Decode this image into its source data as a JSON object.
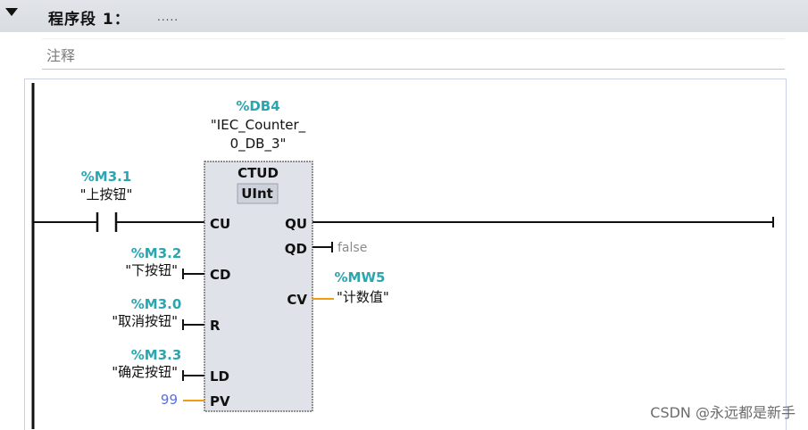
{
  "network": {
    "title": "程序段 1：",
    "title_dots": ".....",
    "comment": "注释"
  },
  "block": {
    "instance_address": "%DB4",
    "instance_name_line1": "\"IEC_Counter_",
    "instance_name_line2": "0_DB_3\"",
    "type": "CTUD",
    "datatype": "UInt",
    "inputs": {
      "cu": "CU",
      "cd": "CD",
      "r": "R",
      "ld": "LD",
      "pv": "PV"
    },
    "outputs": {
      "qu": "QU",
      "qd": "QD",
      "cv": "CV"
    }
  },
  "contact": {
    "address": "%M3.1",
    "symbol": "\"上按钮\""
  },
  "operands": {
    "cd_address": "%M3.2",
    "cd_symbol": "\"下按钮\"",
    "r_address": "%M3.0",
    "r_symbol": "\"取消按钮\"",
    "ld_address": "%M3.3",
    "ld_symbol": "\"确定按钮\"",
    "pv_value": "99",
    "qd_value": "false",
    "cv_address": "%MW5",
    "cv_symbol": "\"计数值\""
  },
  "colors": {
    "address": "#2aa6b0",
    "wire_int": "#f39c12",
    "constant": "#5a6ee0",
    "block_fill": "#dfe2e8"
  },
  "watermark": "CSDN @永远都是新手"
}
